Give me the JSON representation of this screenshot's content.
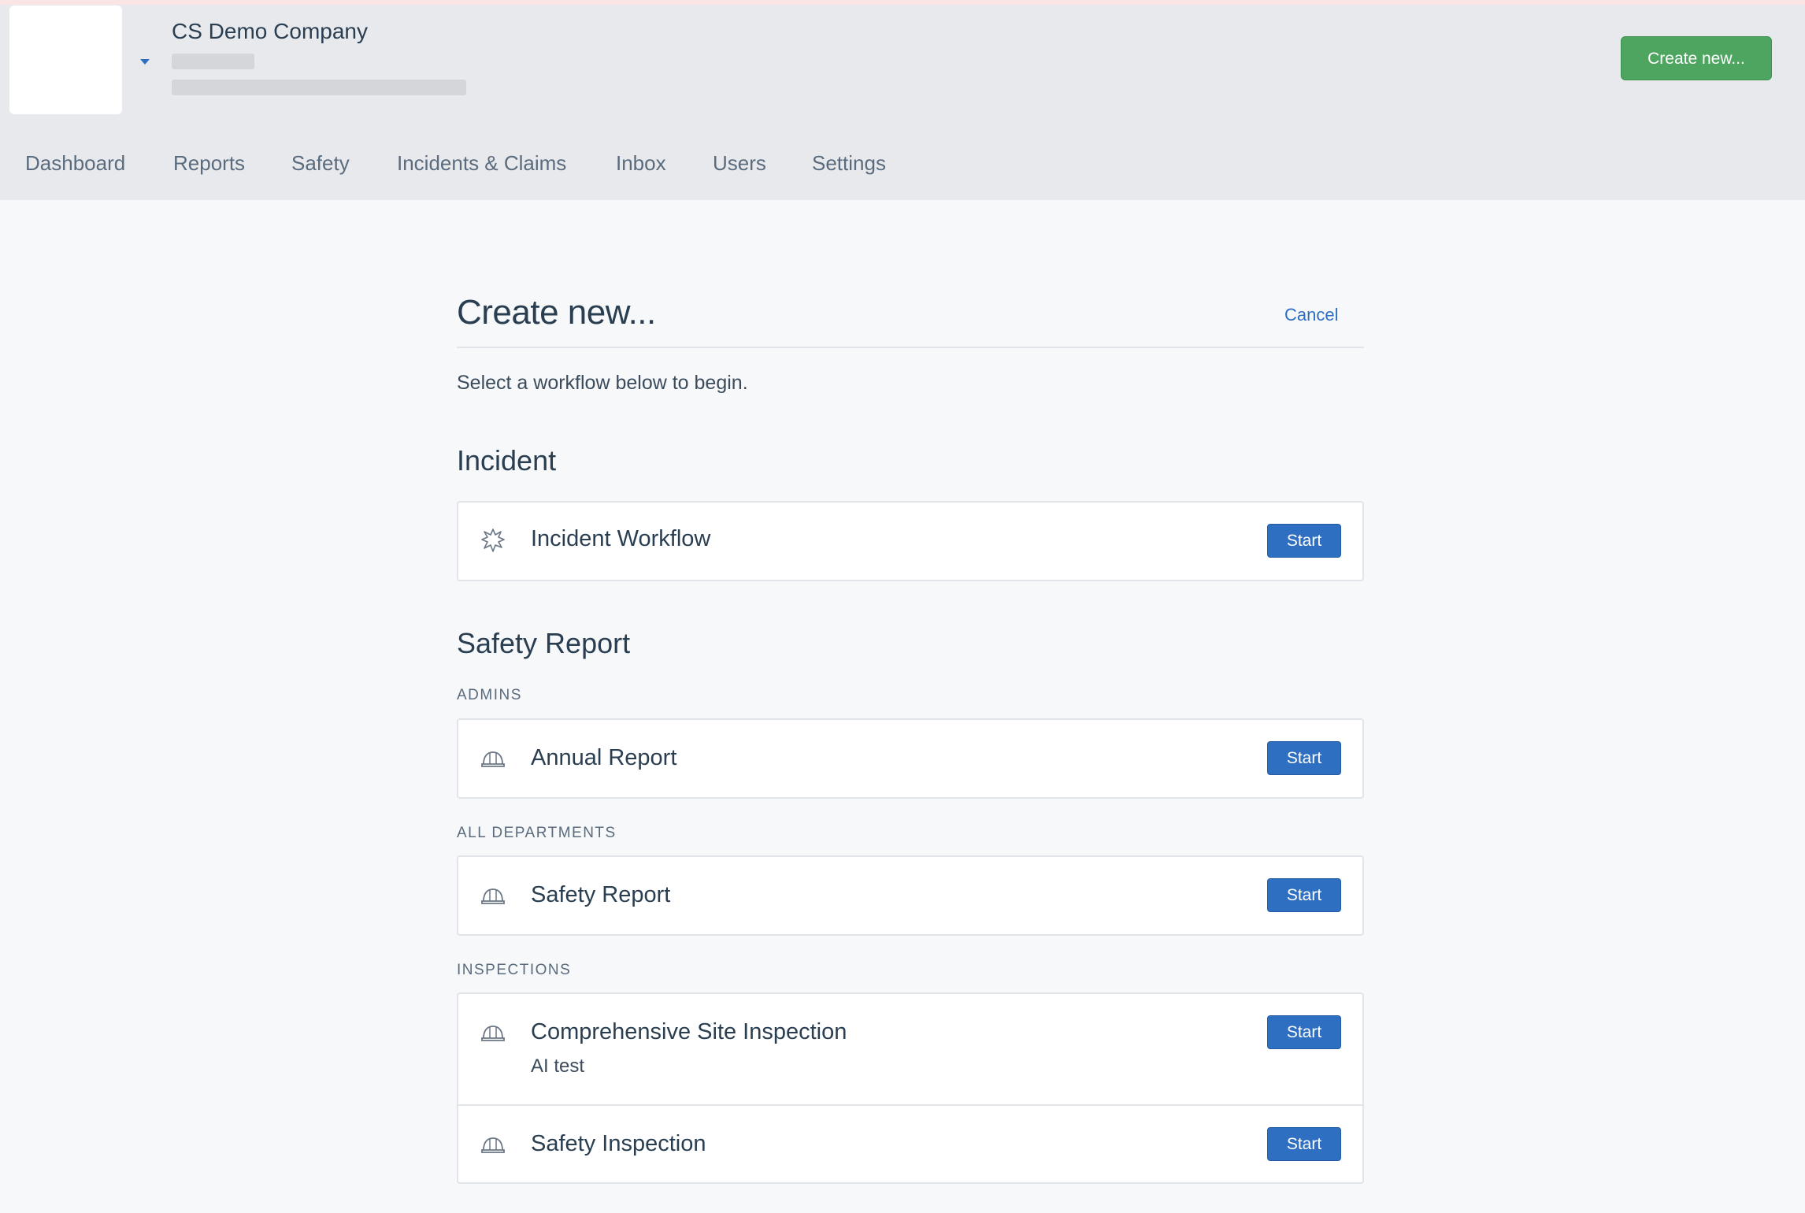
{
  "header": {
    "company_name": "CS Demo Company",
    "create_button": "Create new..."
  },
  "nav": {
    "items": [
      {
        "label": "Dashboard"
      },
      {
        "label": "Reports"
      },
      {
        "label": "Safety"
      },
      {
        "label": "Incidents & Claims"
      },
      {
        "label": "Inbox"
      },
      {
        "label": "Users"
      },
      {
        "label": "Settings"
      }
    ]
  },
  "main": {
    "title": "Create new...",
    "cancel": "Cancel",
    "intro": "Select a workflow below to begin.",
    "sections": [
      {
        "title": "Incident",
        "workflows": [
          {
            "title": "Incident Workflow",
            "icon": "burst-icon",
            "action": "Start"
          }
        ]
      },
      {
        "title": "Safety Report",
        "groups": [
          {
            "label": "ADMINS",
            "workflows": [
              {
                "title": "Annual Report",
                "icon": "hard-hat-icon",
                "action": "Start"
              }
            ]
          },
          {
            "label": "ALL DEPARTMENTS",
            "workflows": [
              {
                "title": "Safety Report",
                "icon": "hard-hat-icon",
                "action": "Start"
              }
            ]
          },
          {
            "label": "INSPECTIONS",
            "workflows": [
              {
                "title": "Comprehensive Site Inspection",
                "subtitle": "AI test",
                "icon": "hard-hat-icon",
                "action": "Start"
              },
              {
                "title": "Safety Inspection",
                "icon": "hard-hat-icon",
                "action": "Start"
              }
            ]
          }
        ]
      }
    ]
  },
  "colors": {
    "accent_blue": "#2f6fc1",
    "create_green": "#4ea560",
    "header_bg": "#e8e9ed",
    "page_bg": "#f7f8fa"
  }
}
